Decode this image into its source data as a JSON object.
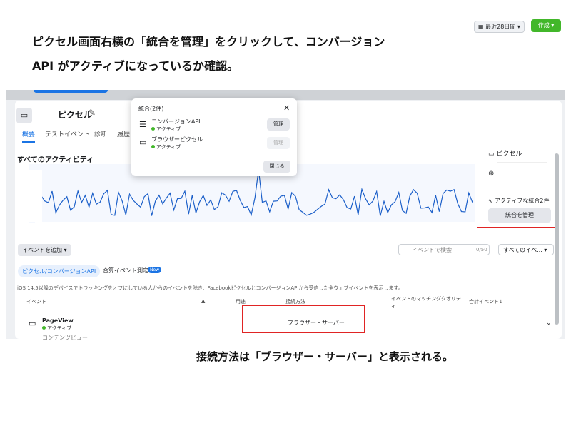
{
  "instructions": {
    "line1": "ピクセル画面右横の「統合を管理」をクリックして、コンバージョン",
    "line2": "API がアクティブになっているか確認。",
    "caption": "接続方法は「ブラウザー・サーバー」と表示される。"
  },
  "header": {
    "pixel_title": "ピクセル",
    "period_label": "最近28日間",
    "create_label": "作成"
  },
  "tabs": [
    "概要",
    "テストイベント",
    "診断",
    "履歴"
  ],
  "chart": {
    "title": "すべてのアクティビティ"
  },
  "sidebar": {
    "pixel_label": "ピクセル",
    "active_integrations": "アクティブな統合2件",
    "manage_button": "統合を管理"
  },
  "dialog": {
    "title": "統合(2件)",
    "items": [
      {
        "name": "コンバージョンAPI",
        "status": "アクティブ",
        "button": "管理"
      },
      {
        "name": "ブラウザーピクセル",
        "status": "アクティブ",
        "button": "管理"
      }
    ],
    "close_label": "閉じる"
  },
  "controls": {
    "add_event": "イベントを追加",
    "search_placeholder": "イベントで検索",
    "count": "0/50",
    "all_events": "すべてのイベ..."
  },
  "subtabs": {
    "pixel_capi": "ピクセル/コンバージョンAPI",
    "aggregated": "合算イベント測定",
    "new_badge": "New"
  },
  "note": "iOS 14.5以降のデバイスでトラッキングをオフにしている人からのイベントを除き、FacebookピクセルとコンバージョンAPIから受信した全ウェブイベントを表示します。",
  "table": {
    "headers": [
      "イベント",
      "用途",
      "接続方法",
      "イベントのマッチングクオリティ",
      "合計イベント↓"
    ],
    "row": {
      "name": "PageView",
      "status": "アクティブ",
      "method": "ブラウザー・サーバー"
    },
    "row2_name": "コンテンツビュー"
  }
}
